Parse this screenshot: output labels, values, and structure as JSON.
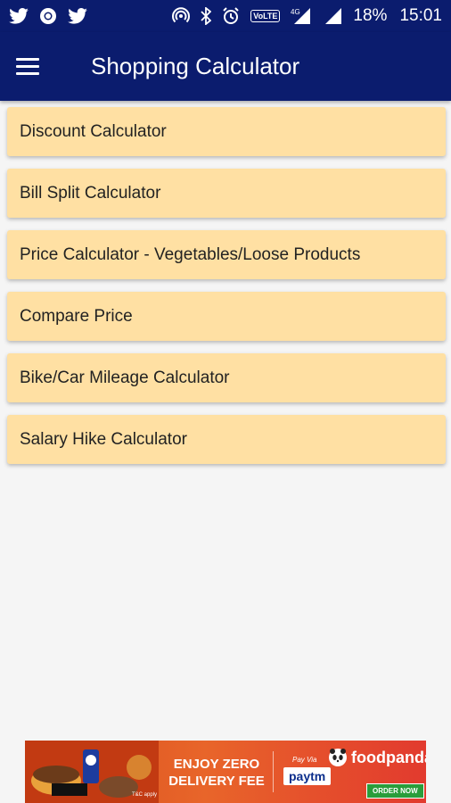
{
  "status_bar": {
    "battery": "18%",
    "time": "15:01",
    "volte_label": "VoLTE",
    "network_label": "4G",
    "icons": [
      "twitter-icon",
      "chrome-icon",
      "twitter-icon",
      "hotspot-icon",
      "bluetooth-icon",
      "alarm-icon",
      "volte-icon",
      "signal-icon",
      "signal-icon"
    ]
  },
  "app_bar": {
    "title": "Shopping Calculator",
    "menu_icon": "hamburger-menu-icon"
  },
  "menu_items": [
    {
      "label": "Discount Calculator"
    },
    {
      "label": "Bill Split Calculator"
    },
    {
      "label": "Price Calculator - Vegetables/Loose Products"
    },
    {
      "label": "Compare Price"
    },
    {
      "label": "Bike/Car Mileage Calculator"
    },
    {
      "label": "Salary Hike Calculator"
    }
  ],
  "ad": {
    "headline_line1": "ENJOY ZERO",
    "headline_line2": "DELIVERY FEE",
    "pay_via": "Pay Via",
    "payment_brand": "paytm",
    "brand": "foodpanda",
    "cta": "ORDER NOW",
    "tc": "T&C apply"
  },
  "colors": {
    "primary": "#0b1c6e",
    "card": "#ffe0a3",
    "background": "#f5f5f5"
  }
}
